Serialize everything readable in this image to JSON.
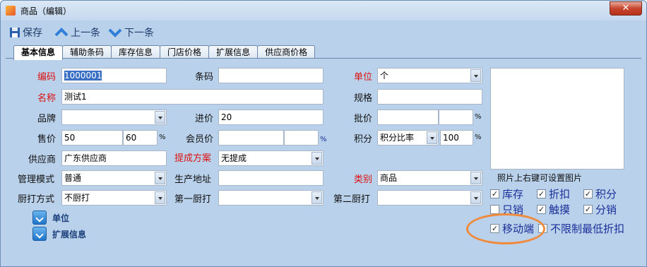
{
  "window": {
    "title": "商品（编辑）",
    "close_glyph": "✕"
  },
  "toolbar": {
    "save": "保存",
    "prev": "上一条",
    "next": "下一条"
  },
  "tabs": [
    "基本信息",
    "辅助条码",
    "库存信息",
    "门店价格",
    "扩展信息",
    "供应商价格"
  ],
  "form": {
    "code_label": "编码",
    "code_value": "1000001",
    "barcode_label": "条码",
    "barcode_value": "",
    "unit_label": "单位",
    "unit_value": "个",
    "name_label": "名称",
    "name_value": "测试1",
    "spec_label": "规格",
    "spec_value": "",
    "brand_label": "品牌",
    "brand_value": "",
    "cost_label": "进价",
    "cost_value": "20",
    "wholesale_label": "批价",
    "wholesale_value": "",
    "wholesale_pct": "",
    "sale_label": "售价",
    "sale_value": "50",
    "sale_pct": "60",
    "member_label": "会员价",
    "member_value": "",
    "member_pct": "",
    "points_label": "积分",
    "points_mode": "积分比率",
    "points_pct": "100",
    "supplier_label": "供应商",
    "supplier_value": "广东供应商",
    "commission_label": "提成方案",
    "commission_value": "无提成",
    "mgmt_label": "管理模式",
    "mgmt_value": "普通",
    "origin_label": "生产地址",
    "origin_value": "",
    "category_label": "类别",
    "category_value": "商品",
    "kitchen_mode_label": "厨打方式",
    "kitchen_mode_value": "不厨打",
    "kitchen1_label": "第一厨打",
    "kitchen1_value": "",
    "kitchen2_label": "第二厨打",
    "kitchen2_value": "",
    "pct_sign": "%"
  },
  "photo": {
    "caption": "照片上右键可设置图片"
  },
  "checks": [
    {
      "label": "库存",
      "checked": true
    },
    {
      "label": "折扣",
      "checked": true
    },
    {
      "label": "积分",
      "checked": true
    },
    {
      "label": "只销",
      "checked": false
    },
    {
      "label": "触摸",
      "checked": true
    },
    {
      "label": "分销",
      "checked": true
    },
    {
      "label": "移动端",
      "checked": true
    },
    {
      "label": "不限制最低折扣",
      "checked": false
    }
  ],
  "sections": {
    "unit": "单位",
    "ext": "扩展信息"
  },
  "colors": {
    "window_bg": "#b9d1ea",
    "required_label": "#dd1111",
    "check_label": "#1b2f9a",
    "annotation": "#f08a3c"
  }
}
